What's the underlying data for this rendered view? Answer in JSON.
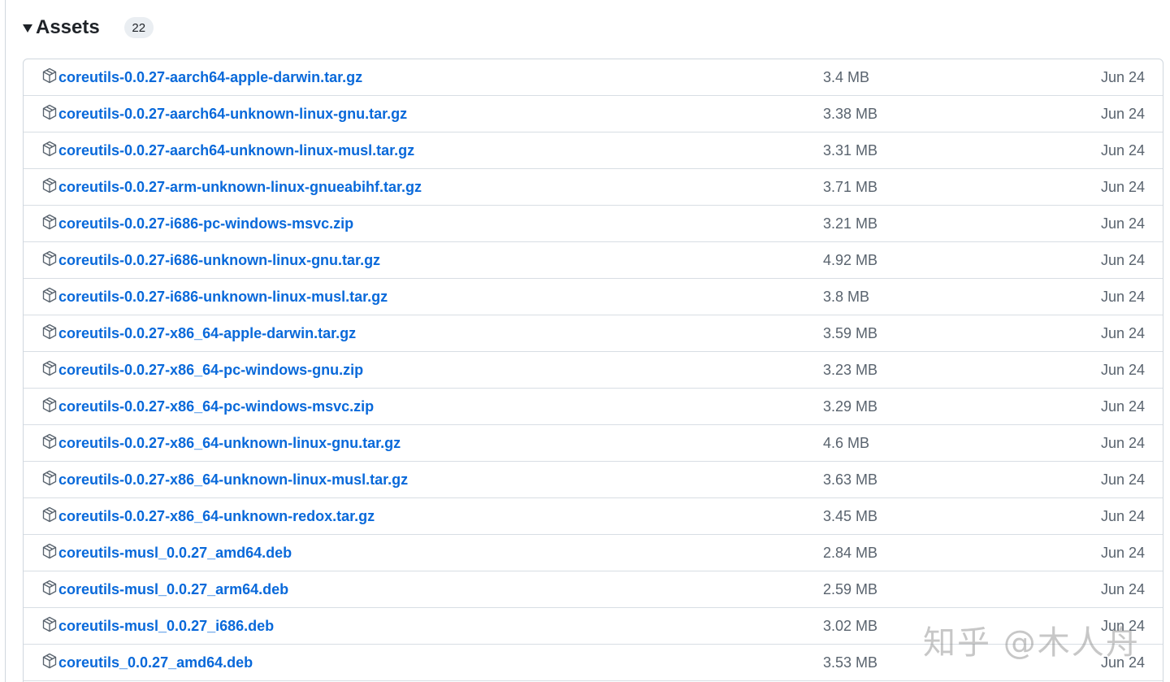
{
  "assets_section": {
    "title": "Assets",
    "count": "22",
    "expanded": true,
    "colors": {
      "link": "#0969da",
      "muted_text": "#59636e",
      "border": "#d0d7de",
      "badge_bg": "#eaeef2"
    },
    "icon": "package-icon",
    "items": [
      {
        "name": "coreutils-0.0.27-aarch64-apple-darwin.tar.gz",
        "size": "3.4 MB",
        "date": "Jun 24"
      },
      {
        "name": "coreutils-0.0.27-aarch64-unknown-linux-gnu.tar.gz",
        "size": "3.38 MB",
        "date": "Jun 24"
      },
      {
        "name": "coreutils-0.0.27-aarch64-unknown-linux-musl.tar.gz",
        "size": "3.31 MB",
        "date": "Jun 24"
      },
      {
        "name": "coreutils-0.0.27-arm-unknown-linux-gnueabihf.tar.gz",
        "size": "3.71 MB",
        "date": "Jun 24"
      },
      {
        "name": "coreutils-0.0.27-i686-pc-windows-msvc.zip",
        "size": "3.21 MB",
        "date": "Jun 24"
      },
      {
        "name": "coreutils-0.0.27-i686-unknown-linux-gnu.tar.gz",
        "size": "4.92 MB",
        "date": "Jun 24"
      },
      {
        "name": "coreutils-0.0.27-i686-unknown-linux-musl.tar.gz",
        "size": "3.8 MB",
        "date": "Jun 24"
      },
      {
        "name": "coreutils-0.0.27-x86_64-apple-darwin.tar.gz",
        "size": "3.59 MB",
        "date": "Jun 24"
      },
      {
        "name": "coreutils-0.0.27-x86_64-pc-windows-gnu.zip",
        "size": "3.23 MB",
        "date": "Jun 24"
      },
      {
        "name": "coreutils-0.0.27-x86_64-pc-windows-msvc.zip",
        "size": "3.29 MB",
        "date": "Jun 24"
      },
      {
        "name": "coreutils-0.0.27-x86_64-unknown-linux-gnu.tar.gz",
        "size": "4.6 MB",
        "date": "Jun 24"
      },
      {
        "name": "coreutils-0.0.27-x86_64-unknown-linux-musl.tar.gz",
        "size": "3.63 MB",
        "date": "Jun 24"
      },
      {
        "name": "coreutils-0.0.27-x86_64-unknown-redox.tar.gz",
        "size": "3.45 MB",
        "date": "Jun 24"
      },
      {
        "name": "coreutils-musl_0.0.27_amd64.deb",
        "size": "2.84 MB",
        "date": "Jun 24"
      },
      {
        "name": "coreutils-musl_0.0.27_arm64.deb",
        "size": "2.59 MB",
        "date": "Jun 24"
      },
      {
        "name": "coreutils-musl_0.0.27_i686.deb",
        "size": "3.02 MB",
        "date": "Jun 24"
      },
      {
        "name": "coreutils_0.0.27_amd64.deb",
        "size": "3.53 MB",
        "date": "Jun 24"
      }
    ]
  },
  "watermark": {
    "text": "知乎 @木人舟"
  }
}
